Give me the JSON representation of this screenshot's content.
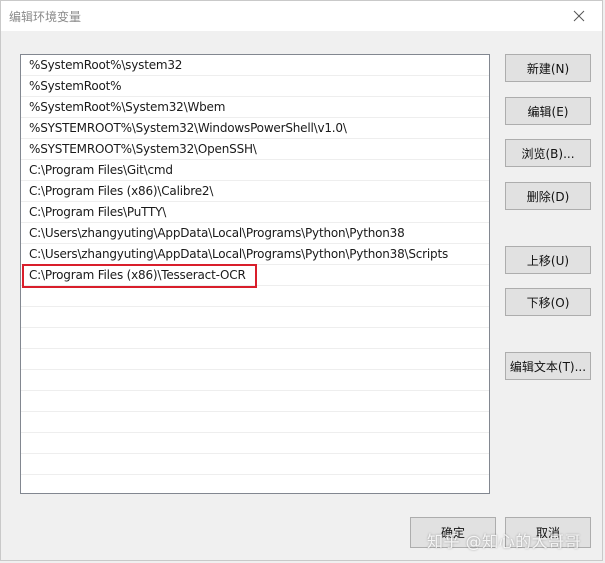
{
  "window": {
    "title": "编辑环境变量"
  },
  "path_list": {
    "items": [
      "%SystemRoot%\\system32",
      "%SystemRoot%",
      "%SystemRoot%\\System32\\Wbem",
      "%SYSTEMROOT%\\System32\\WindowsPowerShell\\v1.0\\",
      "%SYSTEMROOT%\\System32\\OpenSSH\\",
      "C:\\Program Files\\Git\\cmd",
      "C:\\Program Files (x86)\\Calibre2\\",
      "C:\\Program Files\\PuTTY\\",
      "C:\\Users\\zhangyuting\\AppData\\Local\\Programs\\Python\\Python38",
      "C:\\Users\\zhangyuting\\AppData\\Local\\Programs\\Python\\Python38\\Scripts",
      "C:\\Program Files (x86)\\Tesseract-OCR"
    ],
    "highlighted_item": "C:\\Program Files (x86)\\Tesseract-OCR",
    "highlight_color": "#d91e2b"
  },
  "buttons": {
    "new": "新建(N)",
    "edit": "编辑(E)",
    "browse": "浏览(B)...",
    "delete": "删除(D)",
    "move_up": "上移(U)",
    "move_down": "下移(O)",
    "edit_text": "编辑文本(T)...",
    "ok": "确定",
    "cancel": "取消"
  },
  "watermark": "知乎 @知心的大哥哥"
}
